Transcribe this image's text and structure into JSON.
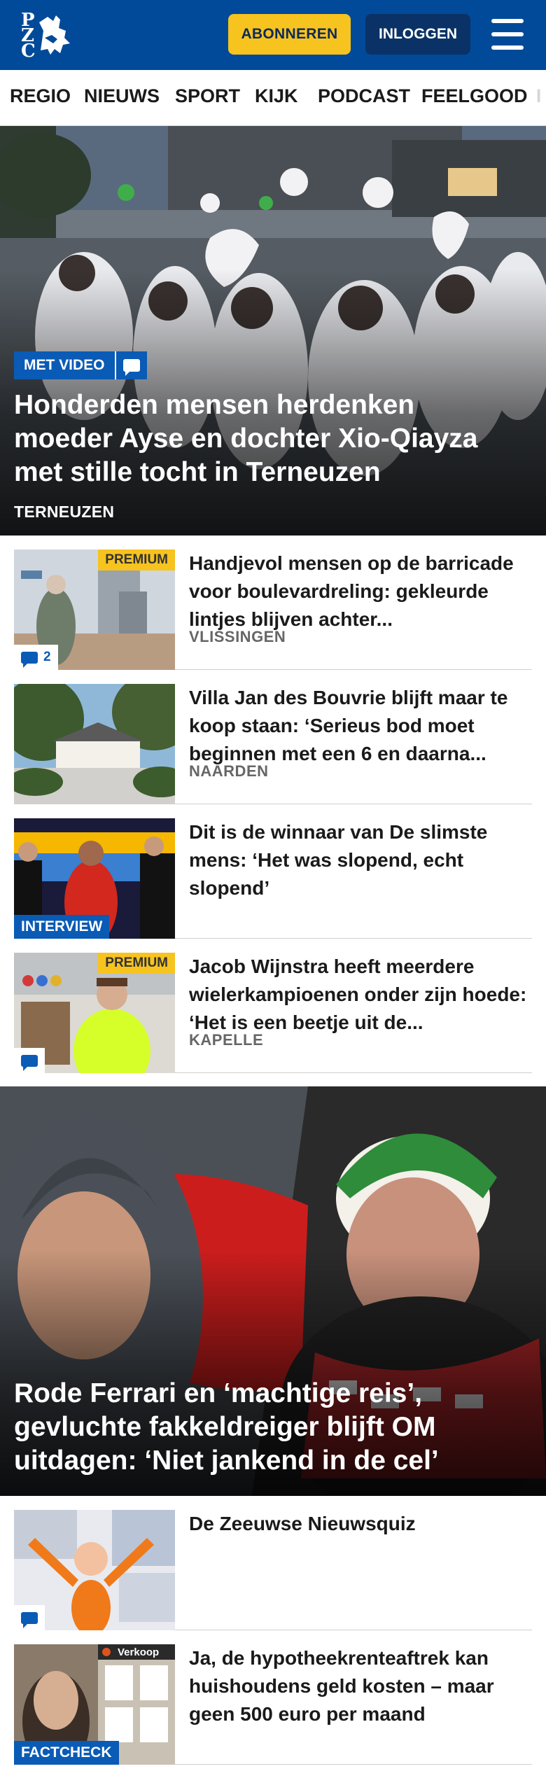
{
  "header": {
    "logo_text": "PZC",
    "subscribe_label": "ABONNEREN",
    "login_label": "INLOGGEN",
    "menu_icon": "hamburger-menu-icon",
    "brand_color": "#004a99",
    "accent_color": "#f7c31f"
  },
  "nav": {
    "items": [
      "REGIO",
      "NIEUWS",
      "SPORT",
      "KIJK",
      "PODCAST",
      "FEELGOOD"
    ]
  },
  "hero": {
    "badge": "MET VIDEO",
    "badge_icon": "comment-icon",
    "title": "Honderden mensen herdenken moeder Ayse en dochter Xio-Qiayza met stille tocht in Terneuzen",
    "location": "TERNEUZEN"
  },
  "articles": [
    {
      "title": "Handjevol mensen op de barricade voor boulevardreling: gekleurde lintjes blijven achter...",
      "location": "VLISSINGEN",
      "premium": "PREMIUM",
      "comments": "2"
    },
    {
      "title": "Villa Jan des Bouvrie blijft maar te koop staan: ‘Serieus bod moet beginnen met een 6 en daarna...",
      "location": "NAARDEN"
    },
    {
      "title": "Dit is de winnaar van De slimste mens: ‘Het was slopend, echt slopend’",
      "tag": "INTERVIEW"
    },
    {
      "title": "Jacob Wijnstra heeft meerdere wielerkampioenen onder zijn hoede: ‘Het is een beetje uit de...",
      "location": "KAPELLE",
      "premium": "PREMIUM"
    }
  ],
  "big_story": {
    "title": "Rode Ferrari en ‘machtige reis’, gevluchte fakkeldreiger blijft OM uitdagen: ‘Niet jankend in de cel’"
  },
  "articles2": [
    {
      "title": "De Zeeuwse Nieuwsquiz"
    },
    {
      "title": "Ja, de hypotheekrenteaftrek kan huishoudens geld kosten – maar geen 500 euro per maand",
      "tag": "FACTCHECK",
      "thumb_text": "Verkoop"
    }
  ]
}
